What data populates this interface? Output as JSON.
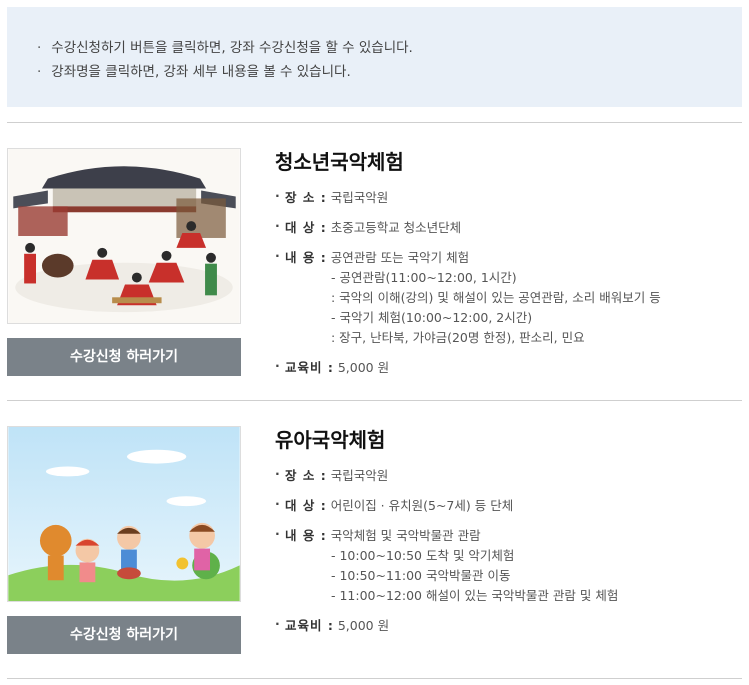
{
  "notice": {
    "items": [
      "수강신청하기 버튼을 클릭하면, 강좌 수강신청을 할 수 있습니다.",
      "강좌명을 클릭하면, 강좌 세부 내용을 볼 수 있습니다."
    ]
  },
  "courses": [
    {
      "title": "청소년국악체험",
      "button_label": "수강신청 하러가기",
      "place_label": "장  소 :",
      "place": "국립국악원",
      "target_label": "대  상 :",
      "target": "초중고등학교 청소년단체",
      "content_label": "내  용 :",
      "content": "공연관람 또는 국악기 체험",
      "content_details": [
        "- 공연관람(11:00~12:00, 1시간)",
        ": 국악의 이해(강의) 및 해설이 있는 공연관람, 소리 배워보기 등",
        "- 국악기 체험(10:00~12:00, 2시간)",
        ": 장구, 난타북, 가야금(20명 한정), 판소리, 민요"
      ],
      "fee_label": "교육비 :",
      "fee": "5,000 원"
    },
    {
      "title": "유아국악체험",
      "button_label": "수강신청 하러가기",
      "place_label": "장  소 :",
      "place": "국립국악원",
      "target_label": "대  상 :",
      "target": "어린이집 · 유치원(5~7세) 등 단체",
      "content_label": "내  용 :",
      "content": "국악체험 및 국악박물관 관람",
      "content_details": [
        "- 10:00~10:50 도착 및 악기체험",
        "- 10:50~11:00 국악박물관 이동",
        "- 11:00~12:00 해설이 있는 국악박물관 관람 및 체험"
      ],
      "fee_label": "교육비 :",
      "fee": "5,000 원"
    }
  ],
  "colors": {
    "notice_bg": "#e9f0f8",
    "button_bg": "#7a8289"
  }
}
